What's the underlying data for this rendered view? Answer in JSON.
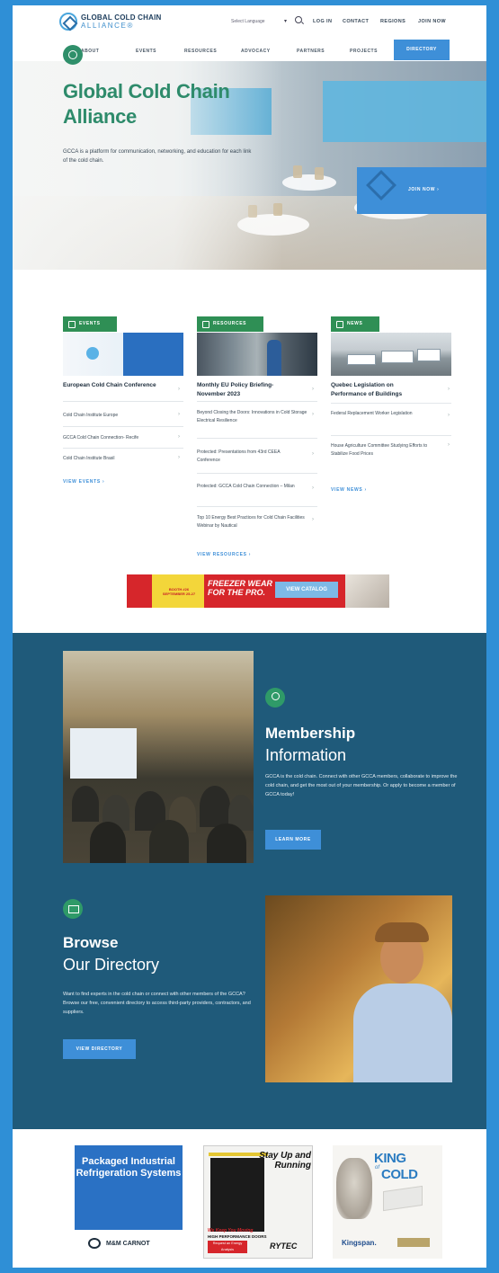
{
  "header": {
    "logo_line1": "GLOBAL COLD CHAIN",
    "logo_line2": "ALLIANCE®",
    "language_select": "Select Language",
    "util_links": [
      "LOG IN",
      "CONTACT",
      "REGIONS",
      "JOIN NOW"
    ]
  },
  "nav": {
    "items": [
      "ABOUT",
      "EVENTS",
      "RESOURCES",
      "ADVOCACY",
      "PARTNERS",
      "PROJECTS",
      "DIRECTORY"
    ],
    "active": "DIRECTORY"
  },
  "hero": {
    "title": "Global Cold Chain Alliance",
    "description": "GCCA is a platform for communication, networking, and education for each link of the cold chain.",
    "join_label": "JOIN NOW ›"
  },
  "cards": {
    "events": {
      "tag": "EVENTS",
      "title": "European Cold Chain Conference",
      "items": [
        "Cold Chain Institute Europe",
        "GCCA Cold Chain Connection- Recife",
        "Cold Chain Institute Brasil"
      ],
      "view_label": "VIEW EVENTS ›"
    },
    "resources": {
      "tag": "RESOURCES",
      "title": "Monthly EU Policy Briefing- November 2023",
      "items": [
        "Beyond Closing the Doors: Innovations in Cold Storage Electrical Resilience",
        "Protected: Presentations from 43rd CEEA Conference",
        "Protected: GCCA Cold Chain Connection – Milan",
        "Top 10 Energy Best Practices for Cold Chain Facilities Webinar by Nautical"
      ],
      "view_label": "VIEW RESOURCES ›"
    },
    "news": {
      "tag": "NEWS",
      "title": "Quebec Legislation on Performance of Buildings",
      "items": [
        "Federal Replacement Worker Legislation",
        "House Agriculture Committee Studying Efforts to Stabilize Food Prices"
      ],
      "view_label": "VIEW NEWS ›"
    }
  },
  "banner_ad": {
    "booth": "BOOTH #26",
    "dates": "SEPTEMBER 25-27",
    "headline": "FREEZER WEAR FOR THE PRO.",
    "cta": "VIEW CATALOG"
  },
  "membership": {
    "title_bold": "Membership",
    "title_light": "Information",
    "description": "GCCA is the cold chain. Connect with other GCCA members, collaborate to improve the cold chain, and get the most out of your membership. Or apply to become a member of GCCA today!",
    "button": "LEARN MORE"
  },
  "browse": {
    "title_bold": "Browse",
    "title_light": "Our Directory",
    "description": "Want to find experts in the cold chain or connect with other members of the GCCA? Browse our free, convenient directory to access third-party providers, contractors, and suppliers.",
    "button": "VIEW DIRECTORY"
  },
  "bottom_ads": {
    "ad1_text": "Packaged Industrial Refrigeration Systems",
    "ad1_brand": "M&M CARNOT",
    "ad2_slogan": "Stay Up and Running",
    "ad2_line1": "We Keep You Moving",
    "ad2_line2": "HIGH PERFORMANCE DOORS",
    "ad2_cta": "Request an Energy Analysis",
    "ad2_brand": "RYTEC",
    "ad3_king": "KING",
    "ad3_of": "of",
    "ad3_cold": "COLD",
    "ad3_brand": "Kingspan."
  },
  "colors": {
    "accent_blue": "#3e8fd8",
    "brand_green": "#2e8b6b",
    "tag_green": "#2f8f55",
    "teal_bg": "#1f5a7a",
    "outer_border": "#2f8fd6"
  }
}
